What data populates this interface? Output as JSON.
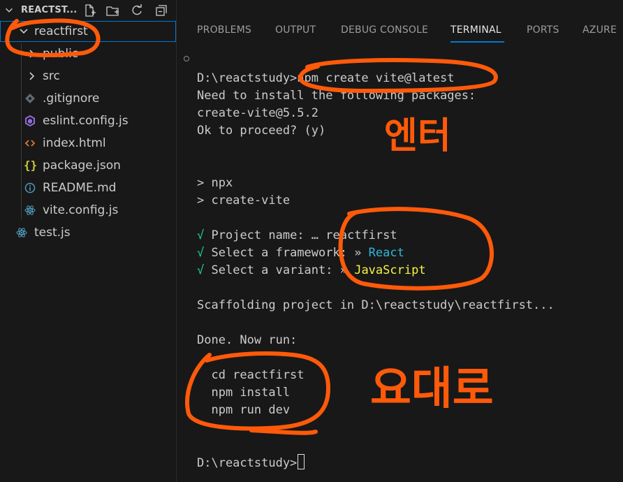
{
  "explorer": {
    "folder_title": "REACTST...",
    "tree": [
      {
        "label": "reactfirst",
        "kind": "folder-open",
        "icon": "chevron-down-icon"
      },
      {
        "label": "public",
        "kind": "folder",
        "icon": "chevron-right-icon"
      },
      {
        "label": "src",
        "kind": "folder",
        "icon": "chevron-right-icon"
      },
      {
        "label": ".gitignore",
        "kind": "file",
        "icon": "git-icon"
      },
      {
        "label": "eslint.config.js",
        "kind": "file",
        "icon": "eslint-icon"
      },
      {
        "label": "index.html",
        "kind": "file",
        "icon": "html-icon"
      },
      {
        "label": "package.json",
        "kind": "file",
        "icon": "json-icon"
      },
      {
        "label": "README.md",
        "kind": "file",
        "icon": "info-icon"
      },
      {
        "label": "vite.config.js",
        "kind": "file",
        "icon": "react-icon"
      },
      {
        "label": "test.js",
        "kind": "file",
        "icon": "react-icon"
      }
    ],
    "header_actions": [
      "new-file-icon",
      "new-folder-icon",
      "refresh-icon",
      "collapse-all-icon"
    ]
  },
  "panel": {
    "tabs": [
      {
        "label": "PROBLEMS",
        "active": false
      },
      {
        "label": "OUTPUT",
        "active": false
      },
      {
        "label": "DEBUG CONSOLE",
        "active": false
      },
      {
        "label": "TERMINAL",
        "active": true
      },
      {
        "label": "PORTS",
        "active": false
      },
      {
        "label": "AZURE",
        "active": false
      }
    ]
  },
  "terminal": {
    "lines": {
      "cmd": "D:\\reactstudy>npm create vite@latest",
      "need": "Need to install the following packages:",
      "pkg": "create-vite@5.5.2",
      "proceed": "Ok to proceed? (y)",
      "npx": "> npx",
      "create_vite": "> create-vite",
      "check_mark": "√",
      "project_name_label": "Project name: … ",
      "project_name_value": "reactfirst",
      "framework_label": "Select a framework: » ",
      "framework_value": "React",
      "variant_label": "Select a variant: » ",
      "variant_value": "JavaScript",
      "scaffolding": "Scaffolding project in D:\\reactstudy\\reactfirst...",
      "done": "Done. Now run:",
      "cd": "  cd reactfirst",
      "install": "  npm install",
      "run_dev": "  npm run dev",
      "prompt": "D:\\reactstudy>"
    }
  },
  "annotations": {
    "enter_note": "엔터",
    "as_is_note": "요대로"
  },
  "colors": {
    "background": "#181818",
    "accent": "#0078d4",
    "annotation": "#ff5a0a",
    "terminal_green": "#23d18b",
    "terminal_blue": "#29b8db",
    "terminal_yellow": "#f5f543"
  }
}
